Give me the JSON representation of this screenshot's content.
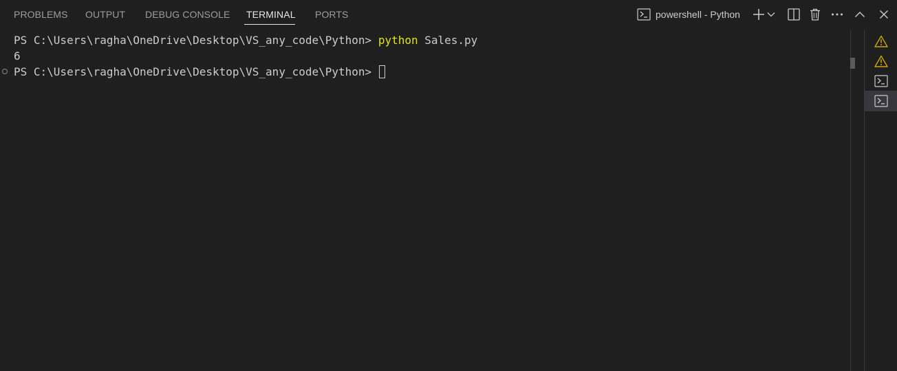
{
  "tabs": [
    {
      "label": "PROBLEMS"
    },
    {
      "label": "OUTPUT"
    },
    {
      "label": "DEBUG CONSOLE"
    },
    {
      "label": "TERMINAL",
      "active": true
    },
    {
      "label": "PORTS"
    }
  ],
  "actions": {
    "terminal_name": "powershell - Python"
  },
  "terminal": {
    "lines": [
      {
        "prompt": "PS C:\\Users\\ragha\\OneDrive\\Desktop\\VS_any_code\\Python> ",
        "command": "python",
        "args": " Sales.py"
      },
      {
        "output": "6"
      },
      {
        "prompt": "PS C:\\Users\\ragha\\OneDrive\\Desktop\\VS_any_code\\Python> "
      }
    ]
  },
  "terminal_tabs": [
    {
      "icon": "warning-icon"
    },
    {
      "icon": "warning-icon"
    },
    {
      "icon": "terminal-icon"
    },
    {
      "icon": "terminal-icon",
      "selected": true
    }
  ],
  "colors": {
    "background": "#1f1f1f",
    "command": "#e5e510",
    "warning": "#cca700",
    "active_tab": "#e7e7e7",
    "inactive_tab": "#9d9d9d"
  }
}
